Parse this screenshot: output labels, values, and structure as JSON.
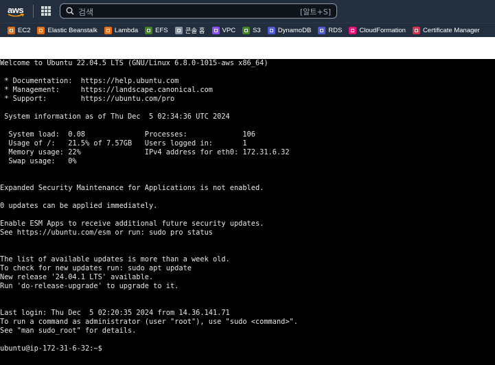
{
  "topbar": {
    "logo_text": "aws",
    "search": {
      "placeholder": "검색",
      "shortcut": "[알트+S]"
    }
  },
  "favorites": [
    {
      "label": "EC2",
      "icon": "ec2-icon",
      "color": "#e7711b"
    },
    {
      "label": "Elastic Beanstalk",
      "icon": "beanstalk-icon",
      "color": "#e7711b"
    },
    {
      "label": "Lambda",
      "icon": "lambda-icon",
      "color": "#e7711b"
    },
    {
      "label": "EFS",
      "icon": "efs-icon",
      "color": "#3f8624"
    },
    {
      "label": "콘솔 홈",
      "icon": "console-home-icon",
      "color": "#8d99a8"
    },
    {
      "label": "VPC",
      "icon": "vpc-icon",
      "color": "#8c4fff"
    },
    {
      "label": "S3",
      "icon": "s3-icon",
      "color": "#3f8624"
    },
    {
      "label": "DynamoDB",
      "icon": "dynamodb-icon",
      "color": "#4d5bd9"
    },
    {
      "label": "RDS",
      "icon": "rds-icon",
      "color": "#4d5bd9"
    },
    {
      "label": "CloudFormation",
      "icon": "cloudformation-icon",
      "color": "#e7157b"
    },
    {
      "label": "Certificate Manager",
      "icon": "certificate-manager-icon",
      "color": "#dd344c"
    }
  ],
  "terminal": {
    "lines": [
      "Welcome to Ubuntu 22.04.5 LTS (GNU/Linux 6.8.0-1015-aws x86_64)",
      "",
      " * Documentation:  https://help.ubuntu.com",
      " * Management:     https://landscape.canonical.com",
      " * Support:        https://ubuntu.com/pro",
      "",
      " System information as of Thu Dec  5 02:34:36 UTC 2024",
      "",
      "  System load:  0.08              Processes:             106",
      "  Usage of /:   21.5% of 7.57GB   Users logged in:       1",
      "  Memory usage: 22%               IPv4 address for eth0: 172.31.6.32",
      "  Swap usage:   0%",
      "",
      "",
      "Expanded Security Maintenance for Applications is not enabled.",
      "",
      "0 updates can be applied immediately.",
      "",
      "Enable ESM Apps to receive additional future security updates.",
      "See https://ubuntu.com/esm or run: sudo pro status",
      "",
      "",
      "The list of available updates is more than a week old.",
      "To check for new updates run: sudo apt update",
      "New release '24.04.1 LTS' available.",
      "Run 'do-release-upgrade' to upgrade to it.",
      "",
      "",
      "Last login: Thu Dec  5 02:20:35 2024 from 14.36.141.71",
      "To run a command as administrator (user \"root\"), use \"sudo <command>\".",
      "See \"man sudo_root\" for details.",
      "",
      "ubuntu@ip-172-31-6-32:~$"
    ]
  }
}
